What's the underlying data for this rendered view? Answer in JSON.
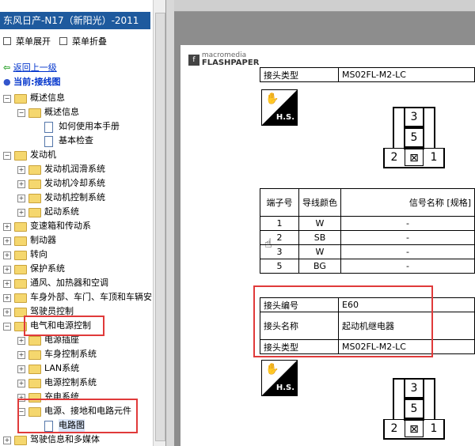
{
  "window": {
    "title": "东风日产-N17（新阳光）-2011"
  },
  "toolbar": {
    "expand_label": "菜单展开",
    "collapse_label": "菜单折叠"
  },
  "nav": {
    "back_label": "返回上一级",
    "current_label": "当前:接线图"
  },
  "tree": {
    "overview": "概述信息",
    "overview_sub": "概述信息",
    "howto": "如何使用本手册",
    "basic_check": "基本检查",
    "engine": "发动机",
    "engine_lube": "发动机润滑系统",
    "engine_cool": "发动机冷却系统",
    "engine_ctrl": "发动机控制系统",
    "start_sys": "起动系统",
    "trans": "变速箱和传动系",
    "brake": "制动器",
    "steer": "转向",
    "protect": "保护系统",
    "hvac": "通风、加热器和空调",
    "body": "车身外部、车门、车顶和车辆安",
    "driver_ctrl": "驾驶员控制",
    "elec": "电气和电源控制",
    "socket": "电源插座",
    "body_ctrl": "车身控制系统",
    "lan": "LAN系统",
    "power_ctrl": "电源控制系统",
    "charge": "充电系统",
    "ground": "电源、接地和电路元件",
    "circuit": "电路图",
    "info": "驾驶信息和多媒体"
  },
  "viewer": {
    "brand_top": "macromedia",
    "brand_bottom": "FLASHPAPER"
  },
  "doc": {
    "row_type_label": "接头类型",
    "row_type_value": "MS02FL-M2-LC",
    "hs_label": "H.S.",
    "pins": [
      "3",
      "5",
      "2",
      "1"
    ],
    "pin_table": {
      "headers": [
        "端子号",
        "导线颜色",
        "信号名称 [规格]"
      ],
      "rows": [
        [
          "1",
          "W",
          "-"
        ],
        [
          "2",
          "SB",
          "-"
        ],
        [
          "3",
          "W",
          "-"
        ],
        [
          "5",
          "BG",
          "-"
        ]
      ]
    },
    "conn2": {
      "no_label": "接头编号",
      "no_value": "E60",
      "name_label": "接头名称",
      "name_value": "起动机继电器",
      "type_label": "接头类型",
      "type_value": "MS02FL-M2-LC"
    }
  },
  "colors": {
    "accent": "#1e5a9e",
    "highlight": "#e03a3a",
    "folder": "#f5d76e"
  }
}
